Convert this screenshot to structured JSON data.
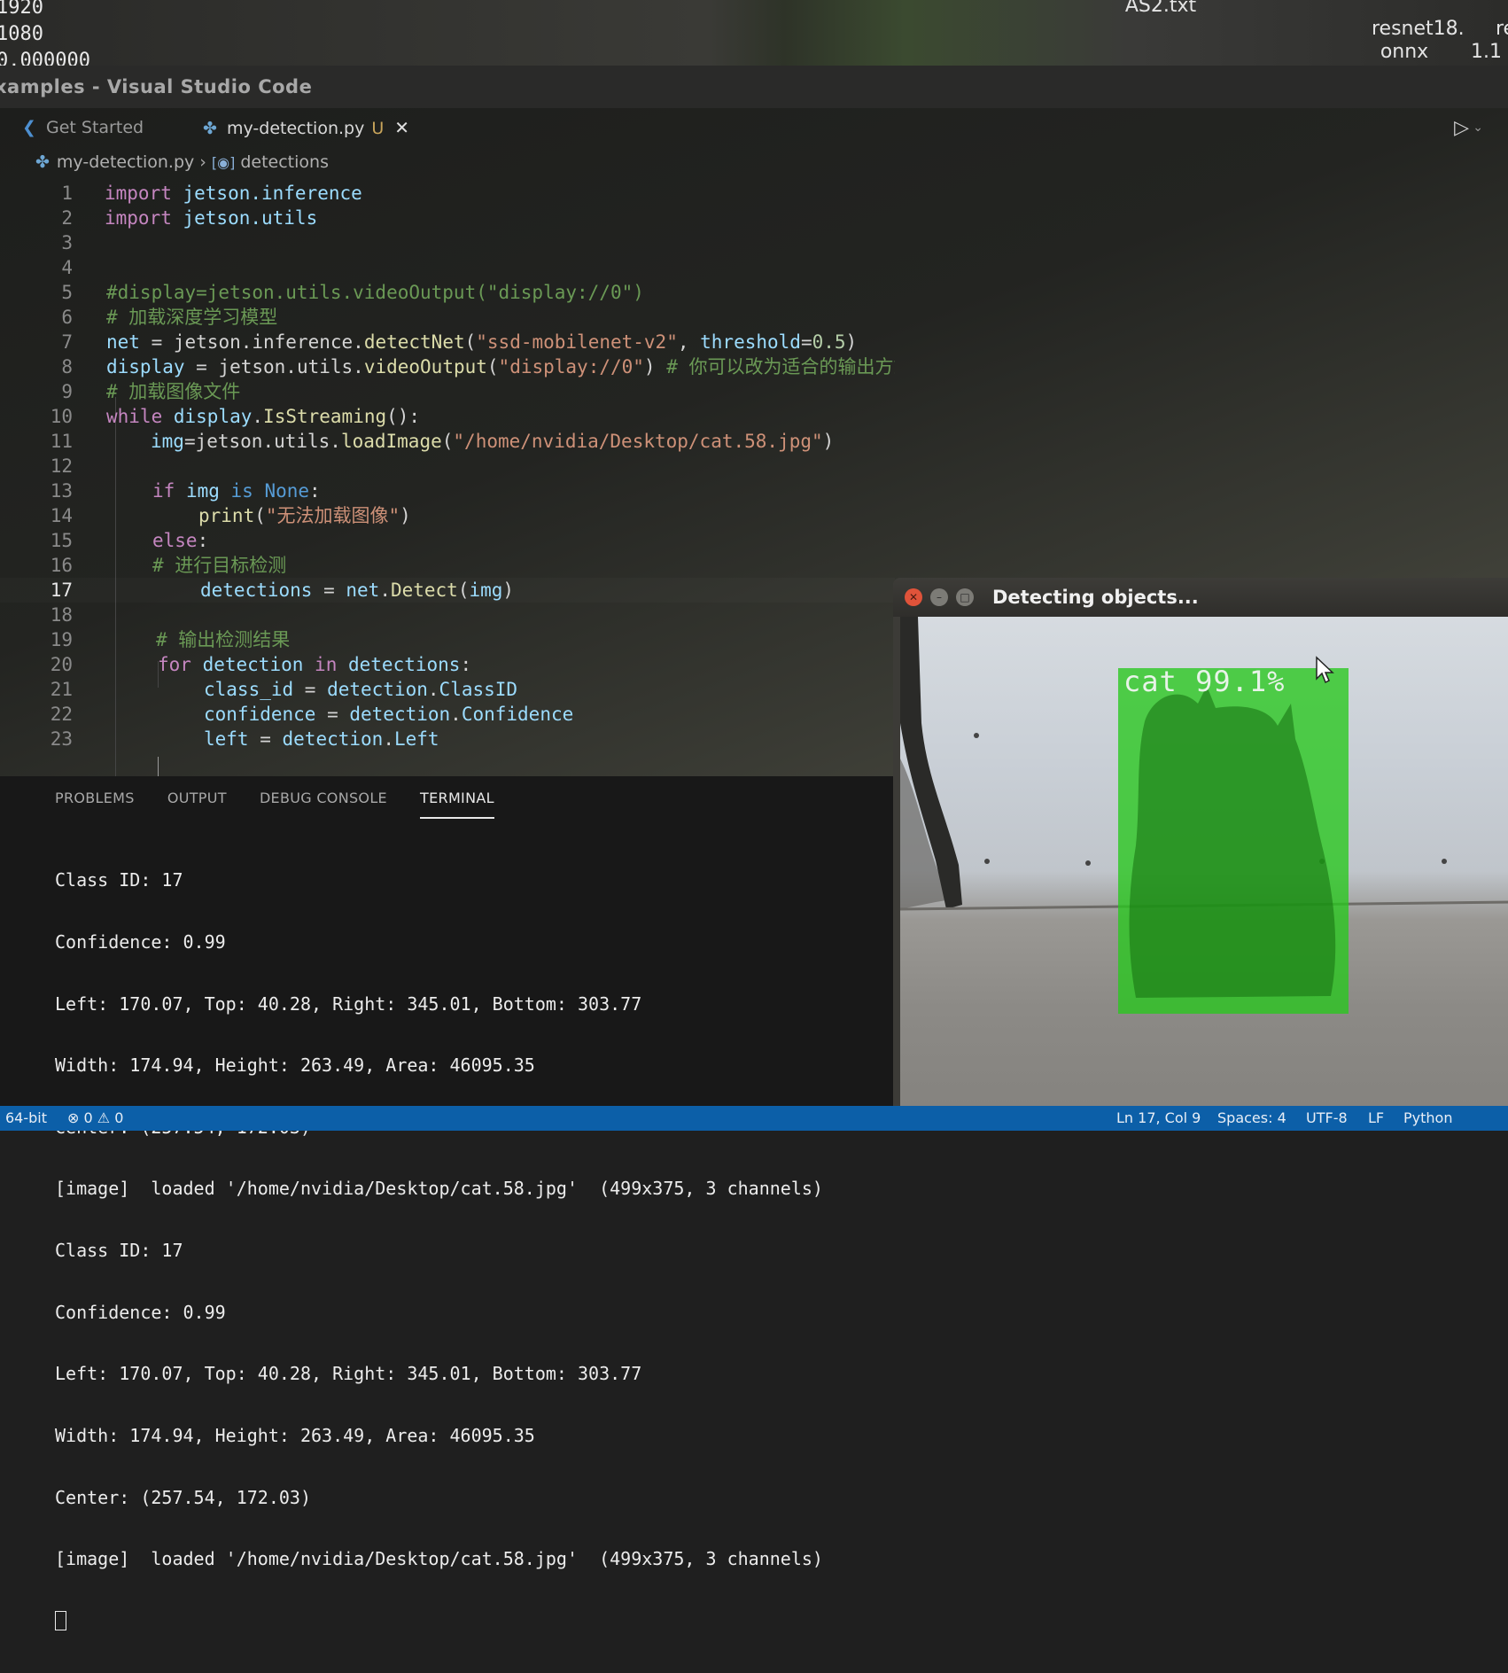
{
  "desktop": {
    "values": [
      "1920",
      "1080",
      "0.000000"
    ],
    "files": [
      {
        "name": "AS2.txt"
      },
      {
        "name": "resnet18.\nonnx"
      },
      {
        "name": "re\n1.1"
      }
    ]
  },
  "window": {
    "title": "xamples - Visual Studio Code"
  },
  "tabs": [
    {
      "label": "Get Started"
    },
    {
      "label": "my-detection.py",
      "status": "U"
    }
  ],
  "breadcrumb": {
    "file": "my-detection.py",
    "symbol": "detections"
  },
  "editor": {
    "active_line": 17,
    "lines": [
      {
        "n": "1"
      },
      {
        "n": "2"
      },
      {
        "n": "3"
      },
      {
        "n": "4"
      },
      {
        "n": "5"
      },
      {
        "n": "6"
      },
      {
        "n": "7"
      },
      {
        "n": "8"
      },
      {
        "n": "9"
      },
      {
        "n": "10"
      },
      {
        "n": "11"
      },
      {
        "n": "12"
      },
      {
        "n": "13"
      },
      {
        "n": "14"
      },
      {
        "n": "15"
      },
      {
        "n": "16"
      },
      {
        "n": "17"
      },
      {
        "n": "18"
      },
      {
        "n": "19"
      },
      {
        "n": "20"
      },
      {
        "n": "21"
      },
      {
        "n": "22"
      },
      {
        "n": "23"
      }
    ],
    "code": {
      "l1": [
        "import",
        " jetson.inference"
      ],
      "l2": [
        "import",
        " jetson.utils"
      ],
      "l5": "#display=jetson.utils.videoOutput(\"display://0\")",
      "l6": "# 加载深度学习模型",
      "l7": [
        "net",
        " = jetson.inference.",
        "detectNet",
        "(",
        "\"ssd-mobilenet-v2\"",
        ", ",
        "threshold",
        "=",
        "0.5",
        ")"
      ],
      "l8": [
        "display",
        " = jetson.utils.",
        "videoOutput",
        "(",
        "\"display://0\"",
        ") ",
        "# 你可以改为适合的输出方式"
      ],
      "l9": "# 加载图像文件",
      "l10": [
        "while",
        " ",
        "display",
        ".",
        "IsStreaming",
        "():"
      ],
      "l11": [
        "img",
        "=jetson.utils.",
        "loadImage",
        "(",
        "\"/home/nvidia/Desktop/cat.58.jpg\"",
        ")"
      ],
      "l13": [
        "if",
        " img ",
        "is",
        " ",
        "None",
        ":"
      ],
      "l14": [
        "print",
        "(",
        "\"无法加载图像\"",
        ")"
      ],
      "l15": [
        "else",
        ":"
      ],
      "l16": "# 进行目标检测",
      "l17": [
        "detections",
        " = ",
        "net",
        ".",
        "Detect",
        "(",
        "img",
        ")"
      ],
      "l19": "# 输出检测结果",
      "l20": [
        "for",
        " ",
        "detection",
        " ",
        "in",
        " ",
        "detections",
        ":"
      ],
      "l21": [
        "class_id",
        " = ",
        "detection",
        ".",
        "ClassID"
      ],
      "l22": [
        "confidence",
        " = ",
        "detection",
        ".",
        "Confidence"
      ],
      "l23": [
        "left",
        " = ",
        "detection",
        ".",
        "Left"
      ]
    }
  },
  "panel": {
    "tabs": [
      "PROBLEMS",
      "OUTPUT",
      "DEBUG CONSOLE",
      "TERMINAL"
    ],
    "active_tab": "TERMINAL",
    "terminal_lines": [
      "Class ID: 17",
      "Confidence: 0.99",
      "Left: 170.07, Top: 40.28, Right: 345.01, Bottom: 303.77",
      "Width: 174.94, Height: 263.49, Area: 46095.35",
      "Center: (257.54, 172.03)",
      "[image]  loaded '/home/nvidia/Desktop/cat.58.jpg'  (499x375, 3 channels)",
      "Class ID: 17",
      "Confidence: 0.99",
      "Left: 170.07, Top: 40.28, Right: 345.01, Bottom: 303.77",
      "Width: 174.94, Height: 263.49, Area: 46095.35",
      "Center: (257.54, 172.03)",
      "[image]  loaded '/home/nvidia/Desktop/cat.58.jpg'  (499x375, 3 channels)"
    ]
  },
  "status_bar": {
    "left": "64-bit",
    "errors": "0",
    "warnings": "0",
    "position": "Ln 17, Col 9",
    "spaces": "Spaces: 4",
    "encoding": "UTF-8",
    "eol": "LF",
    "language": "Python"
  },
  "detect_window": {
    "title": "Detecting objects...",
    "label": "cat  99.1%"
  },
  "icons": {
    "vscode_tab": "vscode-logo-icon",
    "python_file": "python-file-icon",
    "symbol": "variable-symbol-icon",
    "run": "play-icon",
    "close": "close-icon",
    "error": "error-icon",
    "warning": "warning-icon"
  },
  "colors": {
    "status_bar": "#0c5fa8",
    "bbox": "#28c81e",
    "close_button": "#e0533a"
  }
}
